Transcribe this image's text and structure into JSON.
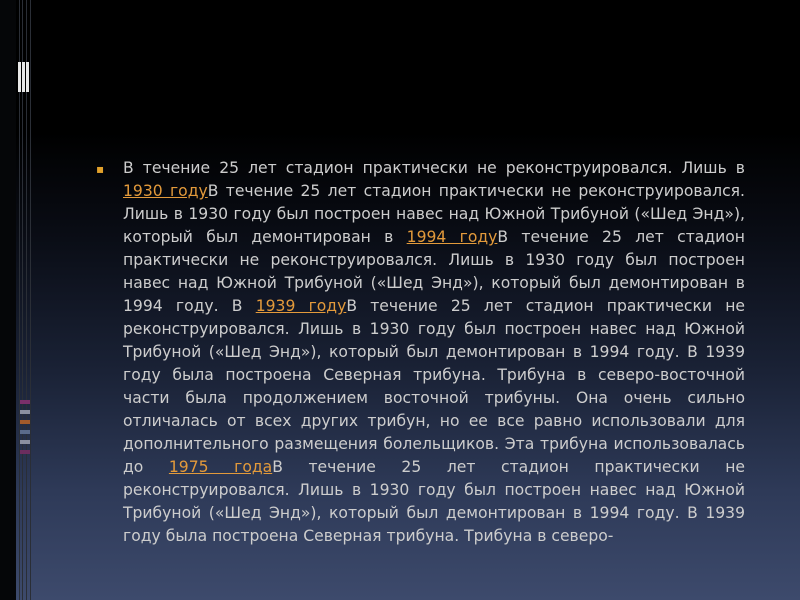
{
  "colors": {
    "text": "#cdcdcd",
    "link": "#e39a3b",
    "bullet": "#e2a12b",
    "background_top": "#000000",
    "background_bottom": "#3d4a6c"
  },
  "bullet_glyph": "▪",
  "body": {
    "seg1": "В течение 25 лет стадион практически не реконструировался. Лишь в ",
    "link1": "1930 году",
    "seg2": "В течение 25 лет стадион практически не реконструировался. Лишь в 1930 году был построен навес над Южной Трибуной («Шед Энд»), который был демонтирован в ",
    "link2": "1994 году",
    "seg3": "В течение 25 лет стадион практически не реконструировался. Лишь в 1930 году был построен навес над Южной Трибуной («Шед Энд»), который был демонтирован в 1994 году. В ",
    "link3": "1939 году",
    "seg4": "В течение 25 лет стадион практически не реконструировался. Лишь в 1930 году был построен навес над Южной Трибуной («Шед Энд»), который был демонтирован в 1994 году. В 1939 году была построена Северная трибуна. Трибуна в северо-восточной части была продолжением восточной трибуны. Она очень сильно отличалась от всех других трибун, но ее все равно использовали для дополнительного размещения болельщиков. Эта трибуна использовалась до ",
    "link4": "1975 года",
    "seg5": "В течение 25 лет стадион практически не реконструировался. Лишь в 1930 году был построен навес над Южной Трибуной («Шед Энд»), который был демонтирован в 1994 году. В 1939 году была построена Северная трибуна. Трибуна в северо-"
  }
}
